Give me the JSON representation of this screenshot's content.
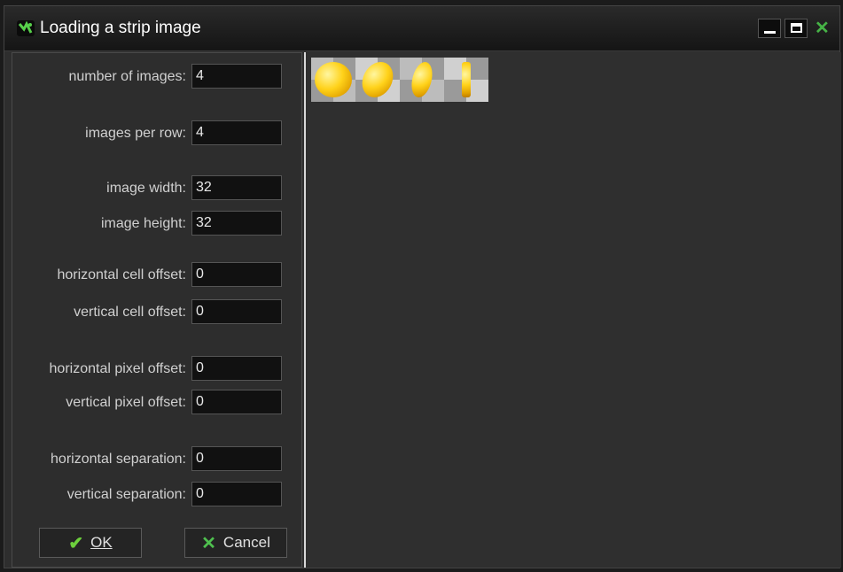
{
  "window": {
    "title": "Loading a strip image",
    "controls": [
      "minimize",
      "maximize",
      "close"
    ]
  },
  "form": {
    "fields": [
      {
        "label": "number of images:",
        "value": "4"
      },
      {
        "label": "images per row:",
        "value": "4"
      },
      {
        "label": "image width:",
        "value": "32"
      },
      {
        "label": "image height:",
        "value": "32"
      },
      {
        "label": "horizontal cell offset:",
        "value": "0"
      },
      {
        "label": "vertical cell offset:",
        "value": "0"
      },
      {
        "label": "horizontal pixel offset:",
        "value": "0"
      },
      {
        "label": "vertical pixel offset:",
        "value": "0"
      },
      {
        "label": "horizontal separation:",
        "value": "0"
      },
      {
        "label": "vertical separation:",
        "value": "0"
      }
    ]
  },
  "buttons": {
    "ok": "OK",
    "cancel": "Cancel"
  },
  "preview": {
    "frames": [
      "coin-frame-1",
      "coin-frame-2",
      "coin-frame-3",
      "coin-frame-4"
    ]
  },
  "colors": {
    "accent_green": "#4fc04f",
    "coin_gold": "#ffd21a"
  }
}
